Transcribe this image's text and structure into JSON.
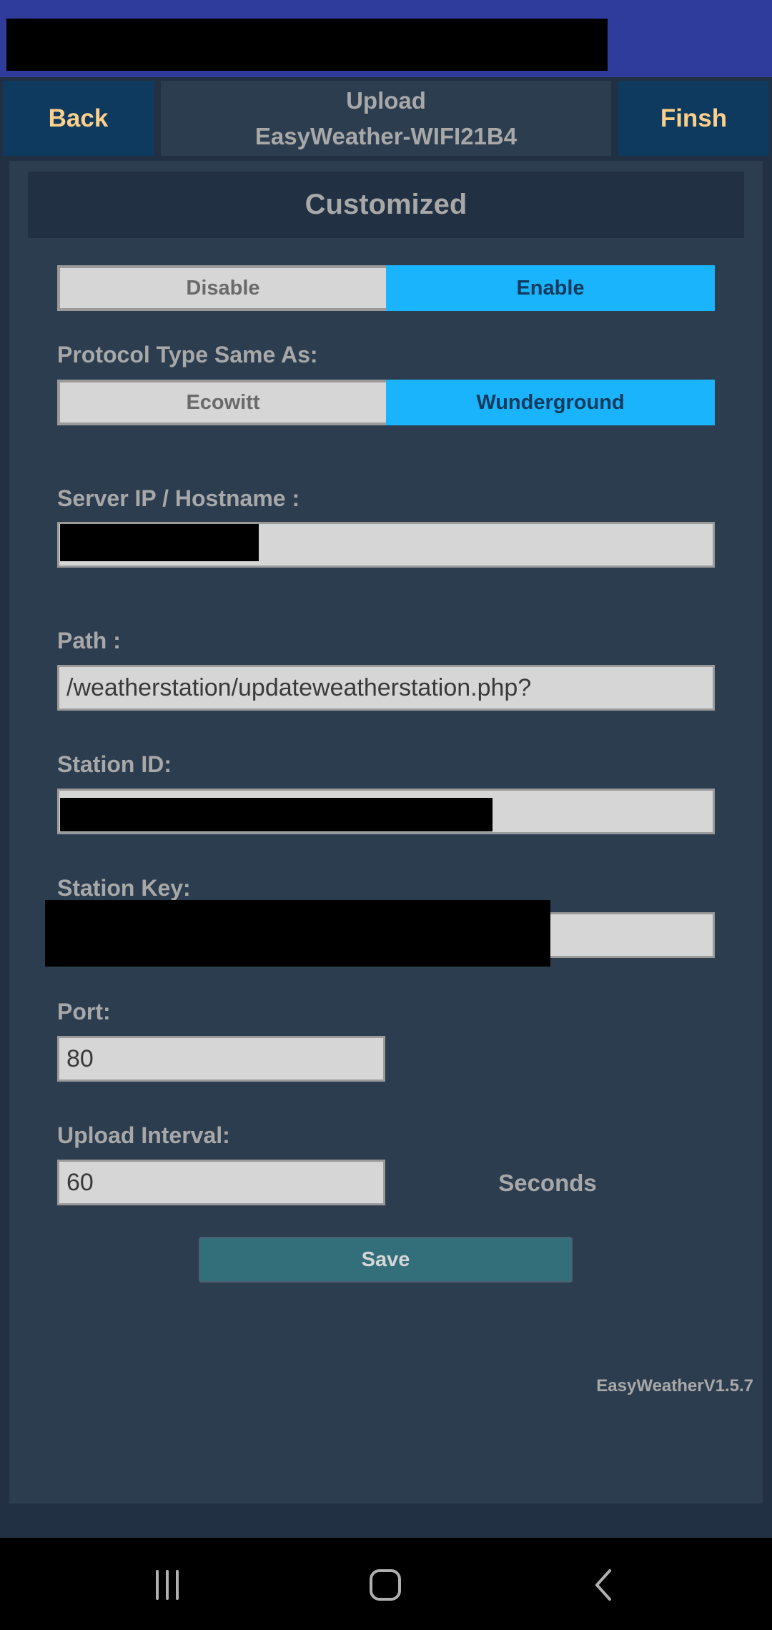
{
  "header": {
    "back_label": "Back",
    "title": "Upload",
    "subtitle": "EasyWeather-WIFI21B4",
    "finish_label": "Finsh"
  },
  "section_title": "Customized",
  "enable_toggle": {
    "options": [
      "Disable",
      "Enable"
    ],
    "selected": "Enable"
  },
  "protocol": {
    "label": "Protocol Type Same As:",
    "options": [
      "Ecowitt",
      "Wunderground"
    ],
    "selected": "Wunderground"
  },
  "fields": {
    "server": {
      "label": "Server IP / Hostname :"
    },
    "path": {
      "label": "Path :",
      "value": "/weatherstation/updateweatherstation.php?"
    },
    "station_id": {
      "label": "Station ID:"
    },
    "station_key": {
      "label": "Station Key:"
    },
    "port": {
      "label": "Port:",
      "value": "80"
    },
    "interval": {
      "label": "Upload Interval:",
      "value": "60",
      "unit": "Seconds"
    }
  },
  "save_label": "Save",
  "version": "EasyWeatherV1.5.7",
  "colors": {
    "accent": "#1ab4fd",
    "header_button": "#0f3a5f",
    "button_text": "#fcd08a",
    "save": "#336f7a",
    "status_bar": "#303c9c"
  }
}
